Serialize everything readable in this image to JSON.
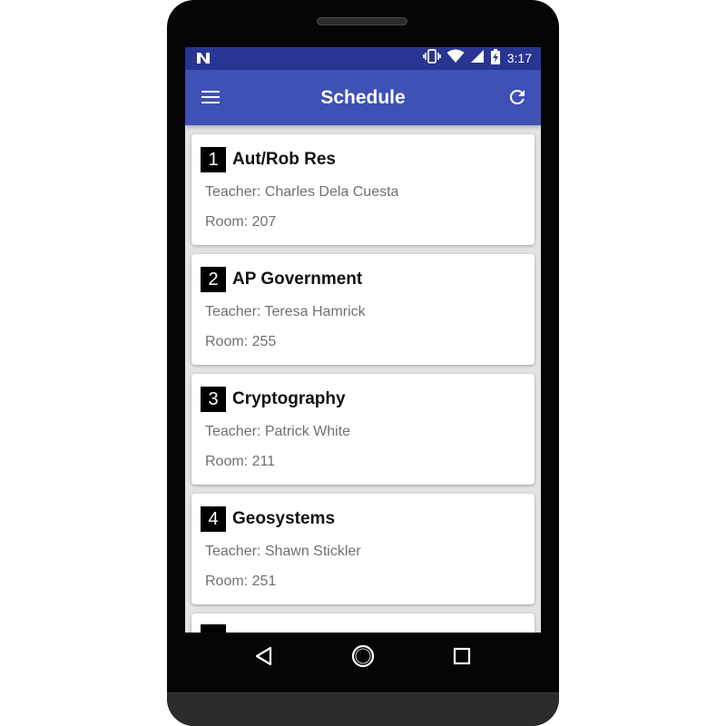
{
  "status_bar": {
    "notification_icon": "n-icon",
    "icons": [
      "vibrate-icon",
      "wifi-icon",
      "signal-icon",
      "battery-charging-icon"
    ],
    "time": "3:17",
    "color": "#283593"
  },
  "app_bar": {
    "menu_icon": "hamburger-menu-icon",
    "title": "Schedule",
    "refresh_icon": "refresh-icon",
    "color": "#3f51b5"
  },
  "schedule": [
    {
      "period": "1",
      "course": "Aut/Rob Res",
      "teacher": "Teacher: Charles Dela Cuesta",
      "room": "Room: 207"
    },
    {
      "period": "2",
      "course": "AP Government",
      "teacher": "Teacher: Teresa Hamrick",
      "room": "Room: 255"
    },
    {
      "period": "3",
      "course": "Cryptography",
      "teacher": "Teacher: Patrick White",
      "room": "Room: 211"
    },
    {
      "period": "4",
      "course": "Geosystems",
      "teacher": "Teacher: Shawn Stickler",
      "room": "Room: 251"
    }
  ],
  "nav_bar": {
    "buttons": [
      "back-icon",
      "home-icon",
      "recents-icon"
    ]
  }
}
